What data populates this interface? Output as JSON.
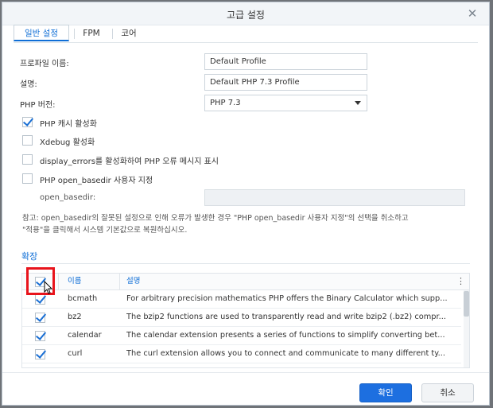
{
  "dialog": {
    "title": "고급 설정",
    "close_glyph": "✕"
  },
  "tabs": [
    {
      "label": "일반 설정",
      "active": true
    },
    {
      "label": "FPM",
      "active": false
    },
    {
      "label": "코어",
      "active": false
    }
  ],
  "form": {
    "profile_name_label": "프로파일 이름:",
    "profile_name_value": "Default Profile",
    "description_label": "설명:",
    "description_value": "Default PHP 7.3 Profile",
    "php_version_label": "PHP 버전:",
    "php_version_value": "PHP 7.3",
    "options": [
      {
        "label": "PHP 캐시 활성화",
        "checked": true
      },
      {
        "label": "Xdebug 활성화",
        "checked": false
      },
      {
        "label": "display_errors를 활성화하여 PHP 오류 메시지 표시",
        "checked": false
      },
      {
        "label": "PHP open_basedir 사용자 지정",
        "checked": false
      }
    ],
    "open_basedir_label": "open_basedir:",
    "open_basedir_value": "",
    "note_line1": "참고: open_basedir의 잘못된 설정으로 인해 오류가 발생한 경우 \"PHP open_basedir 사용자 지정\"의 선택을 취소하고",
    "note_line2": "\"적용\"을 클릭해서 시스템 기본값으로 복원하십시오."
  },
  "extensions": {
    "section_title": "확장",
    "col_name": "이름",
    "col_desc": "설명",
    "menu_glyph": "⋮",
    "rows": [
      {
        "name": "bcmath",
        "desc": "For arbitrary precision mathematics PHP offers the Binary Calculator which supp...",
        "checked": true
      },
      {
        "name": "bz2",
        "desc": "The bzip2 functions are used to transparently read and write bzip2 (.bz2) compr...",
        "checked": true
      },
      {
        "name": "calendar",
        "desc": "The calendar extension presents a series of functions to simplify converting bet...",
        "checked": true
      },
      {
        "name": "curl",
        "desc": "The curl extension allows you to connect and communicate to many different ty...",
        "checked": true
      },
      {
        "name": "",
        "desc": "",
        "checked": true
      }
    ]
  },
  "footer": {
    "ok_label": "확인",
    "cancel_label": "취소"
  },
  "colors": {
    "accent": "#1d6fe0",
    "highlight": "#e8141c"
  }
}
